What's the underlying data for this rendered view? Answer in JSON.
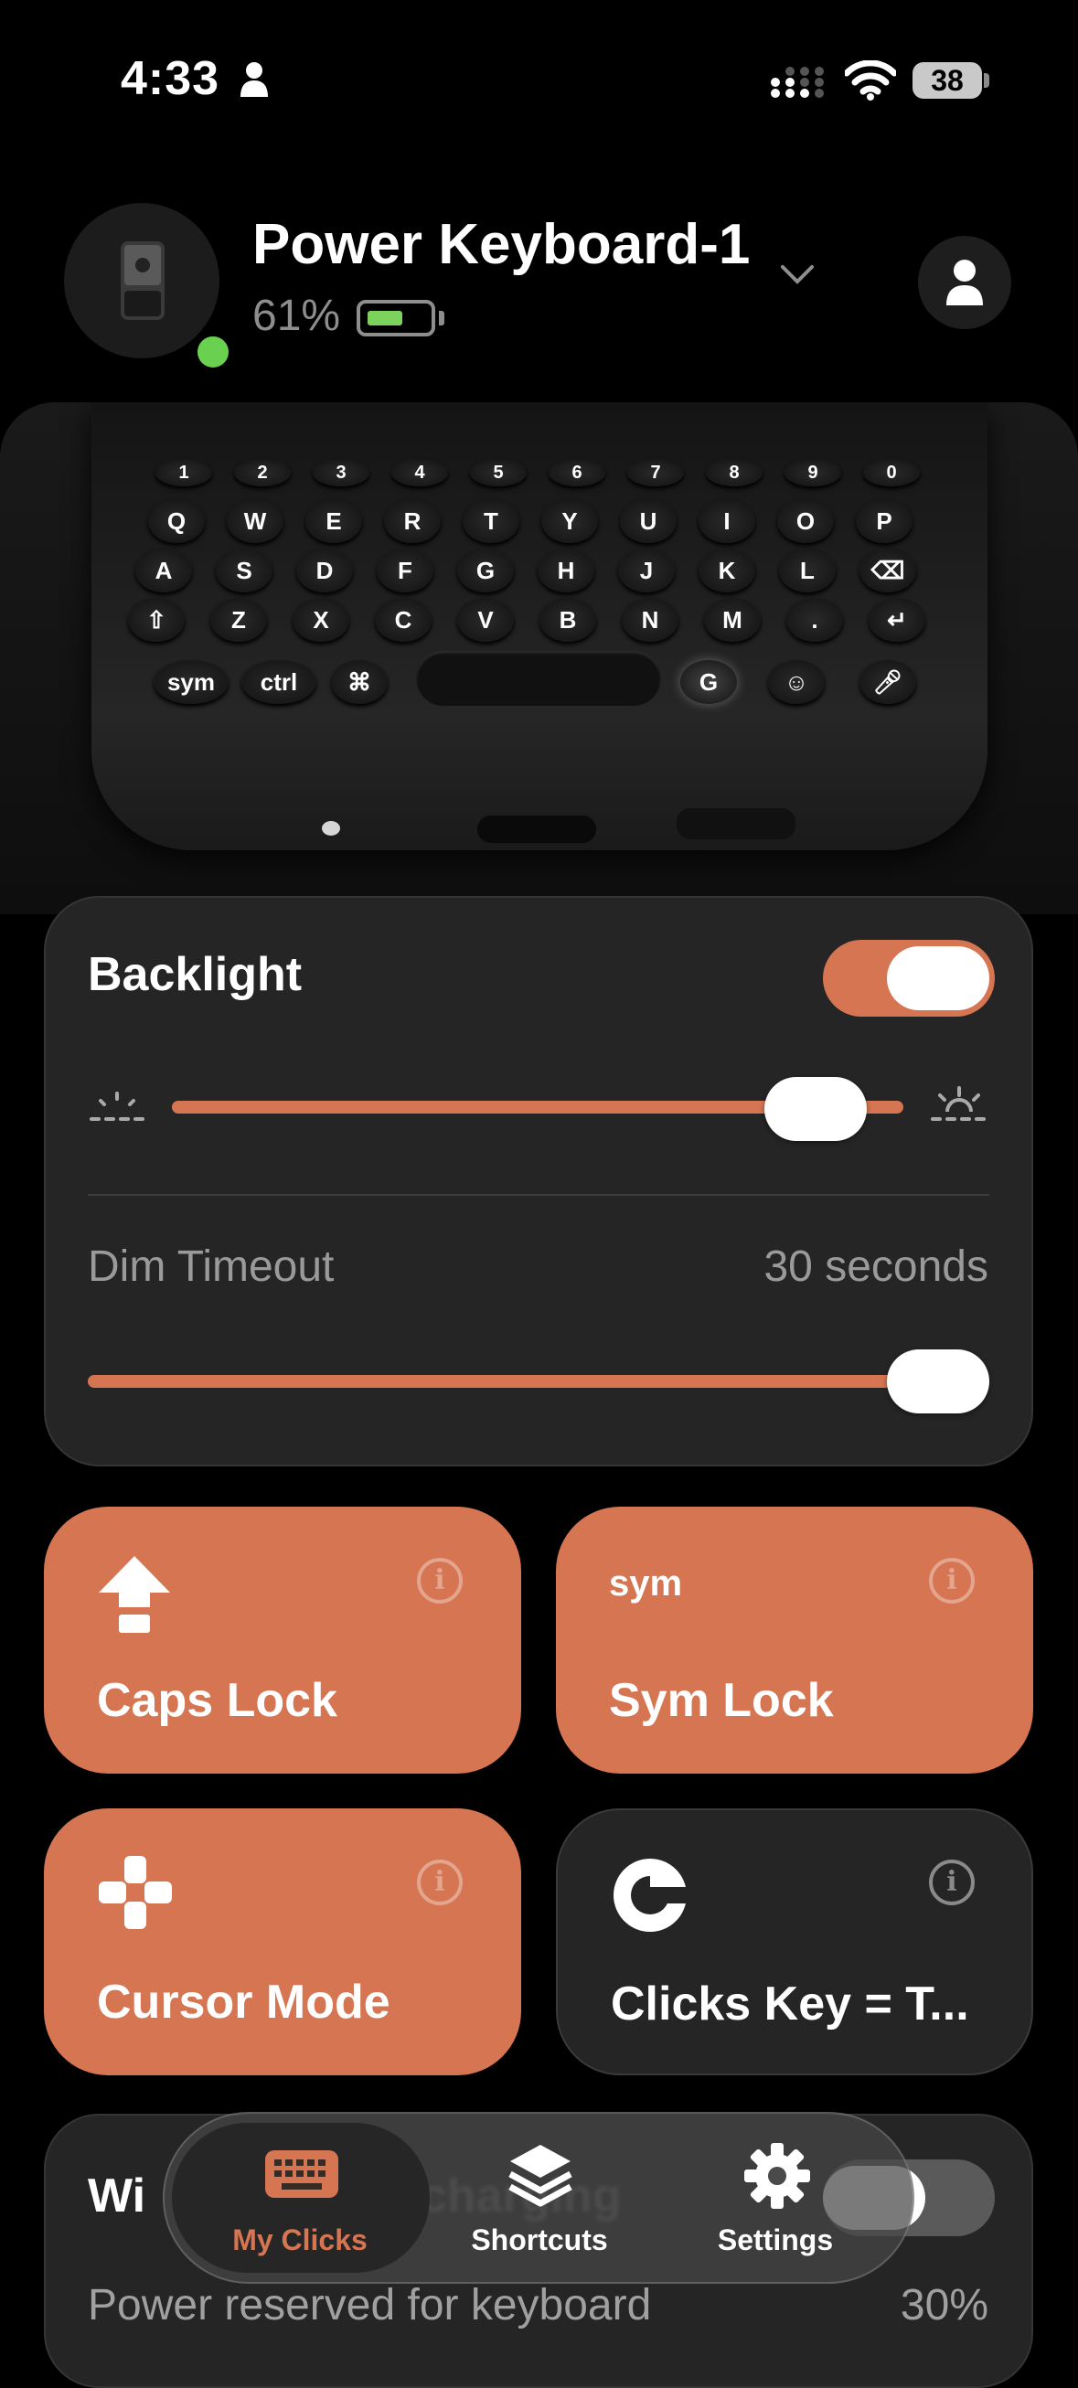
{
  "status_bar": {
    "time": "4:33",
    "battery": "38"
  },
  "header": {
    "device_name": "Power Keyboard-1",
    "battery_percent": "61%"
  },
  "keyboard_rows": [
    [
      "1",
      "2",
      "3",
      "4",
      "5",
      "6",
      "7",
      "8",
      "9",
      "0"
    ],
    [
      "Q",
      "W",
      "E",
      "R",
      "T",
      "Y",
      "U",
      "I",
      "O",
      "P"
    ],
    [
      "A",
      "S",
      "D",
      "F",
      "G",
      "H",
      "J",
      "K",
      "L",
      "⌫"
    ],
    [
      "⇧",
      "Z",
      "X",
      "C",
      "V",
      "B",
      "N",
      "M",
      ".",
      "↵"
    ]
  ],
  "keyboard_bottom": {
    "sym": "sym",
    "ctrl": "ctrl"
  },
  "backlight": {
    "title": "Backlight",
    "enabled": true,
    "brightness_level": 0.92,
    "dim_timeout_label": "Dim Timeout",
    "dim_timeout_value": "30 seconds",
    "dim_timeout_level": 1.0
  },
  "tiles": [
    {
      "label": "Caps Lock",
      "icon": "caps-arrow-icon",
      "active": true
    },
    {
      "label": "Sym Lock",
      "icon_text": "sym",
      "active": true
    },
    {
      "label": "Cursor Mode",
      "icon": "dpad-icon",
      "active": true
    },
    {
      "label": "Clicks Key = T...",
      "icon": "clicks-logo-icon",
      "active": false
    }
  ],
  "wireless_card": {
    "title_partial": "Wi",
    "title_obscured": "charging",
    "sub_label": "Power reserved for keyboard",
    "sub_value": "30%"
  },
  "tab_bar": {
    "items": [
      {
        "label": "My Clicks",
        "icon": "keyboard-icon",
        "active": true
      },
      {
        "label": "Shortcuts",
        "icon": "layers-icon",
        "active": false
      },
      {
        "label": "Settings",
        "icon": "gear-icon",
        "active": false
      }
    ]
  },
  "colors": {
    "accent": "#d57552",
    "card": "#252525",
    "online": "#6ad04f",
    "battery_fill": "#7bd35d"
  }
}
